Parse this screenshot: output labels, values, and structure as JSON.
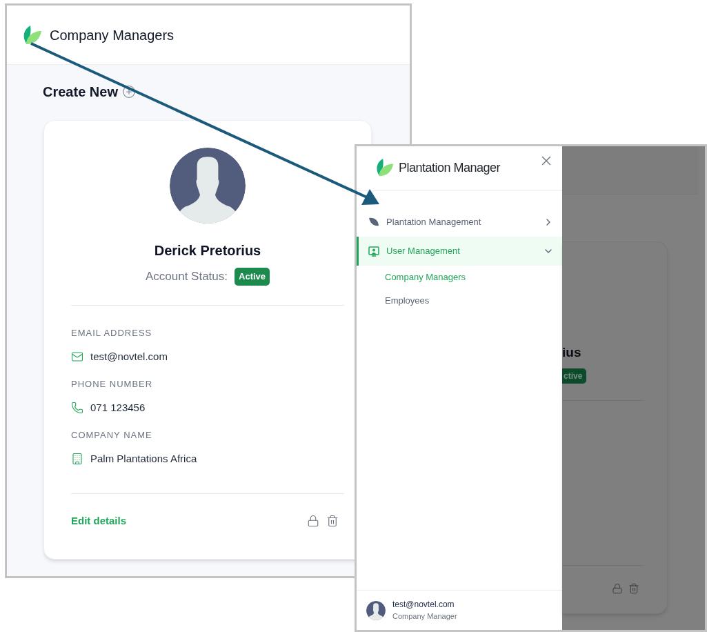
{
  "profile_screen": {
    "header_title": "Company Managers",
    "create_new": "Create New",
    "card": {
      "name": "Derick Pretorius",
      "status_label": "Account Status:",
      "status": "Active",
      "fields": [
        {
          "kind": "email",
          "label": "EMAIL ADDRESS",
          "value": "test@novtel.com"
        },
        {
          "kind": "phone",
          "label": "PHONE NUMBER",
          "value": "071 123456"
        },
        {
          "kind": "company",
          "label": "COMPANY NAME",
          "value": "Palm Plantations Africa"
        }
      ],
      "edit_link": "Edit details"
    }
  },
  "menu_screen": {
    "brand": "Plantation Manager",
    "nav_items": [
      {
        "kind": "plantation",
        "label": "Plantation Management",
        "expanded": false,
        "selected": false
      },
      {
        "kind": "users",
        "label": "User Management",
        "expanded": true,
        "selected": true,
        "children": [
          {
            "label": "Company Managers",
            "selected": true
          },
          {
            "label": "Employees",
            "selected": false
          }
        ]
      }
    ],
    "user": {
      "email": "test@novtel.com",
      "role": "Company Manager"
    },
    "background": {
      "name_fragment": "ius",
      "status_fragment": "ctive"
    }
  }
}
